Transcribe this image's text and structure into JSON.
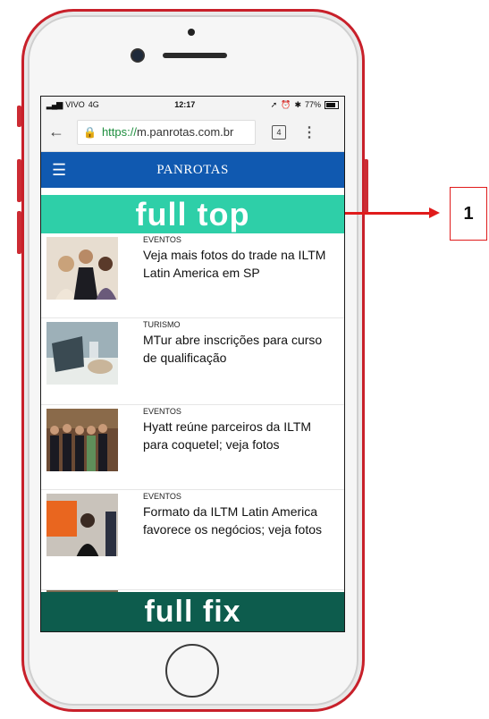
{
  "status_bar": {
    "carrier": "VIVO",
    "network": "4G",
    "time": "12:17",
    "battery": "77%"
  },
  "browser": {
    "url_scheme": "https://",
    "url_host": "m.panrotas.com.br",
    "tab_count": "4"
  },
  "site": {
    "title": "PANROTAS"
  },
  "ads": {
    "top_label": "full top",
    "bottom_label": "full fix"
  },
  "articles": [
    {
      "category": "EVENTOS",
      "headline": "Veja mais fotos do trade na ILTM Latin America em SP"
    },
    {
      "category": "TURISMO",
      "headline": "MTur abre inscrições para curso de qualificação"
    },
    {
      "category": "EVENTOS",
      "headline": "Hyatt reúne parceiros da ILTM para coquetel; veja fotos"
    },
    {
      "category": "EVENTOS",
      "headline": "Formato da ILTM Latin America favorece os negócios; veja fotos"
    }
  ],
  "annotation": {
    "callout_number": "1"
  },
  "colors": {
    "site_bar": "#1059b0",
    "full_top": "#2ecfa8",
    "full_fix": "#0d5c4d",
    "phone_frame": "#c8202a",
    "arrow": "#e01b1b"
  }
}
